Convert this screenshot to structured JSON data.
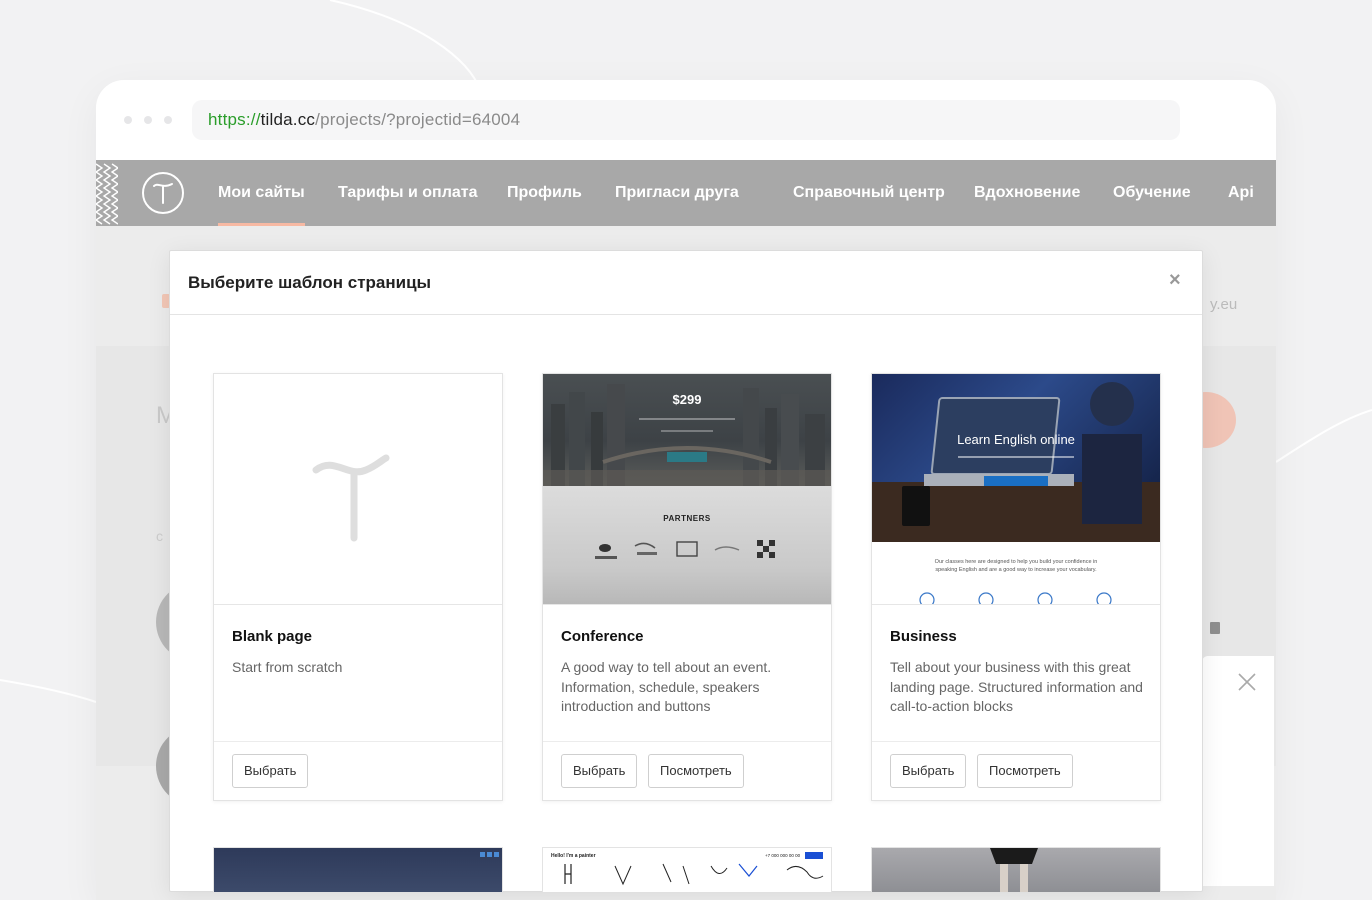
{
  "browser": {
    "url_proto": "https://",
    "url_domain": "tilda.cc",
    "url_path": "/projects/?projectid=64004"
  },
  "nav": {
    "items": [
      {
        "label": "Мои сайты",
        "active": true
      },
      {
        "label": "Тарифы и оплата"
      },
      {
        "label": "Профиль"
      },
      {
        "label": "Пригласи друга"
      },
      {
        "label": "Справочный центр"
      },
      {
        "label": "Вдохновение"
      },
      {
        "label": "Обучение"
      },
      {
        "label": "Api"
      }
    ]
  },
  "background": {
    "domain_suffix": "y.eu"
  },
  "modal": {
    "title": "Выберите шаблон страницы",
    "close_icon": "×",
    "templates": [
      {
        "title": "Blank page",
        "description": "Start from scratch",
        "select_label": "Выбрать"
      },
      {
        "title": "Conference",
        "description": "A good way to tell about an event. Information, schedule, speakers introduction and buttons",
        "select_label": "Выбрать",
        "preview_label": "Посмотреть",
        "thumb_price": "$299",
        "thumb_partners": "PARTNERS"
      },
      {
        "title": "Business",
        "description": "Tell about your business with this great landing page. Structured information and call-to-action blocks",
        "select_label": "Выбрать",
        "preview_label": "Посмотреть",
        "thumb_heading": "Learn English online",
        "thumb_text": "Our classes here are designed to help you build your confidence in speaking English and are a good way to increase your vocabulary."
      }
    ],
    "peek": {
      "second_heading": "Hello! I'm a painter",
      "second_phone": "+7 000 000 00 00"
    }
  },
  "colors": {
    "nav_bg": "#a8a8a8",
    "active_underline": "#f7b9a3",
    "url_green": "#2a9d2a",
    "cta_blue": "#1a6fc4"
  }
}
